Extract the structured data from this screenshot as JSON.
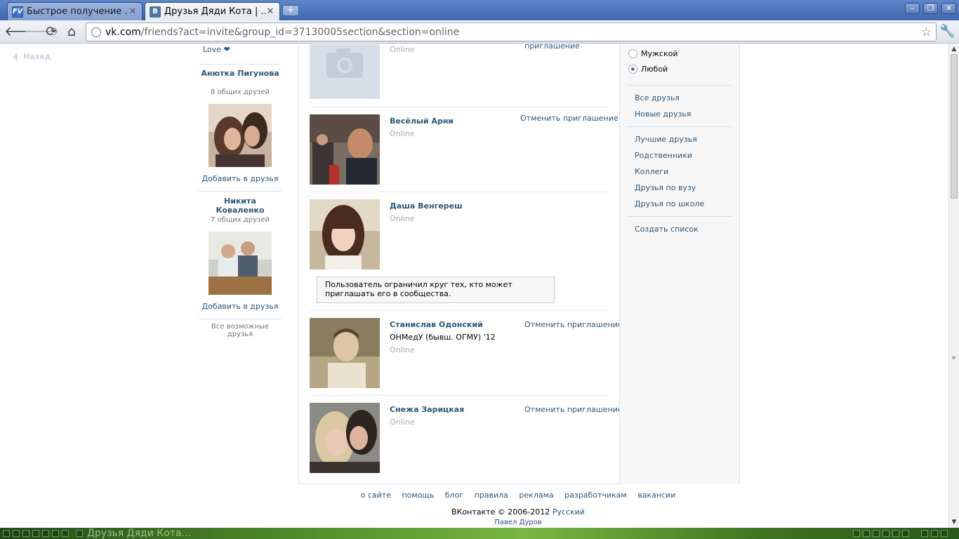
{
  "browser": {
    "tabs": [
      {
        "title": "Быстрое получение ...",
        "favicon": "FV"
      },
      {
        "title": "Друзья Дяди Кота | ...",
        "favicon": "B"
      }
    ],
    "url_host": "vk.com",
    "url_path": "/friends?act=invite&group_id=37130005section&section=online"
  },
  "page": {
    "back_label": "Назад",
    "love_text": "Love ❤",
    "suggestions": [
      {
        "name": "Анютка Пигунова",
        "mutual": "8 общих друзей",
        "add": "Добавить в друзья"
      },
      {
        "name": "Никита Коваленко",
        "mutual": "7 общих друзей",
        "add": "Добавить в друзья"
      }
    ],
    "all_possible": "Все возможные друзья",
    "friends": [
      {
        "name": "",
        "status": "Online",
        "action": "приглашение"
      },
      {
        "name": "Весёлый Арни",
        "status": "Online",
        "action": "Отменить приглашение"
      },
      {
        "name": "Даша Венгереш",
        "status": "Online",
        "action": ""
      },
      {
        "name": "Станислав Одонский",
        "extra": "ОНМедУ (бывш. ОГМУ) '12",
        "status": "Online",
        "action": "Отменить приглашение"
      },
      {
        "name": "Снежа Зарицкая",
        "status": "Online",
        "action": "Отменить приглашение"
      }
    ],
    "restriction_notice": "Пользователь ограничил круг тех, кто может приглашать его в сообщества.",
    "filter": {
      "gender_options": [
        {
          "label": "Мужской",
          "selected": false
        },
        {
          "label": "Любой",
          "selected": true
        }
      ],
      "group1": [
        "Все друзья",
        "Новые друзья"
      ],
      "group2": [
        "Лучшие друзья",
        "Родственники",
        "Коллеги",
        "Друзья по вузу",
        "Друзья по школе"
      ],
      "create_list": "Создать список"
    },
    "footer": {
      "links": [
        "о сайте",
        "помощь",
        "блог",
        "правила",
        "реклама",
        "разработчикам",
        "вакансии"
      ],
      "copyright": "ВКонтакте © 2006-2012",
      "language": "Русский",
      "author": "Павел Дуров"
    }
  },
  "taskbar": {
    "active_task": "Друзья Дяди Кота..."
  },
  "colors": {
    "link": "#2b587a",
    "online": "#aaaaaa",
    "tabstrip": "#4a72b8",
    "panel_bg": "#f7f7f7"
  }
}
